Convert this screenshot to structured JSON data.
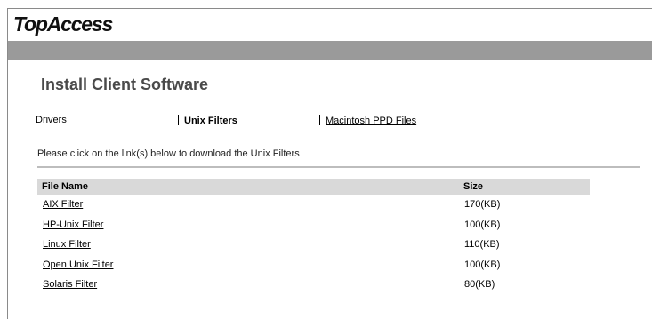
{
  "header": {
    "logo": "TopAccess"
  },
  "page": {
    "title": "Install Client Software"
  },
  "tabs": [
    {
      "label": "Drivers",
      "active": false
    },
    {
      "label": "Unix Filters",
      "active": true
    },
    {
      "label": "Macintosh PPD Files",
      "active": false
    }
  ],
  "instruction": "Please click on the link(s) below to download the Unix Filters",
  "table": {
    "headers": {
      "name": "File Name",
      "size": "Size"
    },
    "rows": [
      {
        "name": "AIX Filter",
        "size": "170(KB)"
      },
      {
        "name": "HP-Unix Filter",
        "size": "100(KB)"
      },
      {
        "name": "Linux Filter",
        "size": "110(KB)"
      },
      {
        "name": "Open Unix Filter",
        "size": "100(KB)"
      },
      {
        "name": "Solaris Filter",
        "size": "80(KB)"
      }
    ]
  },
  "colors": {
    "band": "#9a9a9a",
    "title": "#4a4a4a",
    "table_header": "#d9d9d9"
  }
}
